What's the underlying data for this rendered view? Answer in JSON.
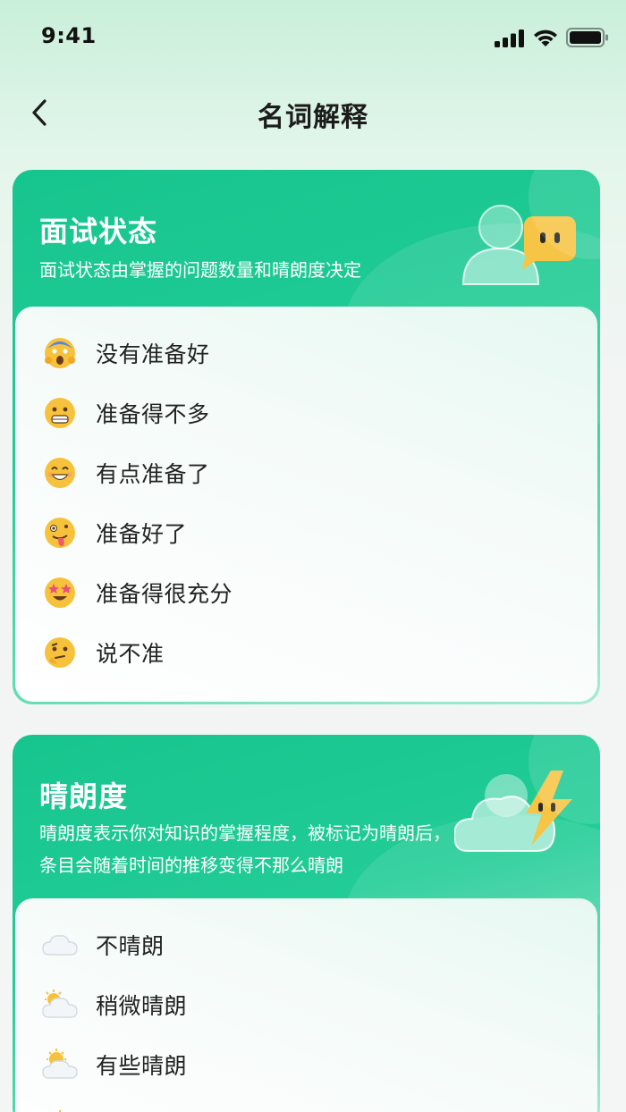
{
  "status_bar": {
    "time": "9:41"
  },
  "nav": {
    "title": "名词解释"
  },
  "interview_status": {
    "title": "面试状态",
    "description": "面试状态由掌握的问题数量和晴朗度决定",
    "items": [
      {
        "icon": "screaming-face-icon",
        "label": "没有准备好"
      },
      {
        "icon": "grimacing-face-icon",
        "label": "准备得不多"
      },
      {
        "icon": "smiling-face-icon",
        "label": "有点准备了"
      },
      {
        "icon": "zany-face-icon",
        "label": "准备好了"
      },
      {
        "icon": "star-struck-face-icon",
        "label": "准备得很充分"
      },
      {
        "icon": "thinking-face-icon",
        "label": "说不准"
      }
    ]
  },
  "clarity": {
    "title": "晴朗度",
    "description": "晴朗度表示你对知识的掌握程度，被标记为晴朗后，条目会随着时间的推移变得不那么晴朗",
    "items": [
      {
        "icon": "cloud-icon",
        "label": "不晴朗"
      },
      {
        "icon": "sun-behind-cloud-icon",
        "label": "稍微晴朗"
      },
      {
        "icon": "sun-behind-cloud-icon",
        "label": "有些晴朗"
      }
    ]
  },
  "colors": {
    "accent": "#16c58d",
    "panel": "#ffffff",
    "text": "#222222"
  }
}
